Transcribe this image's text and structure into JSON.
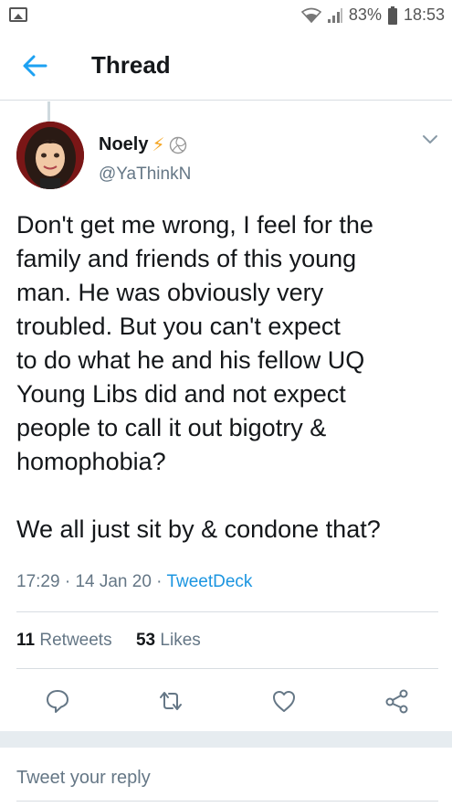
{
  "status_bar": {
    "battery": "83%",
    "time": "18:53"
  },
  "header": {
    "title": "Thread"
  },
  "tweet": {
    "author_name": "Noely",
    "author_emoji": "⚡",
    "handle": "@YaThinkN",
    "text_lines": [
      "Don't get me wrong, I feel for the",
      "family and friends of this young",
      "man. He was obviously very",
      "troubled. But you can't expect",
      "to do what he and his fellow UQ",
      "Young Libs did and not expect",
      "people to call it out bigotry &",
      "homophobia?",
      "",
      "We all just sit by & condone that?"
    ],
    "time": "17:29",
    "date": "14 Jan 20",
    "source": "TweetDeck",
    "retweets_count": "11",
    "retweets_label": "Retweets",
    "likes_count": "53",
    "likes_label": "Likes"
  },
  "actions": {
    "icons": [
      "reply-icon",
      "retweet-icon",
      "like-icon",
      "share-icon"
    ]
  },
  "reply": {
    "placeholder": "Tweet your reply"
  },
  "colors": {
    "accent": "#1da1f2",
    "link": "#1b95e0",
    "secondary_text": "#657786",
    "bolt": "#f5a623"
  }
}
